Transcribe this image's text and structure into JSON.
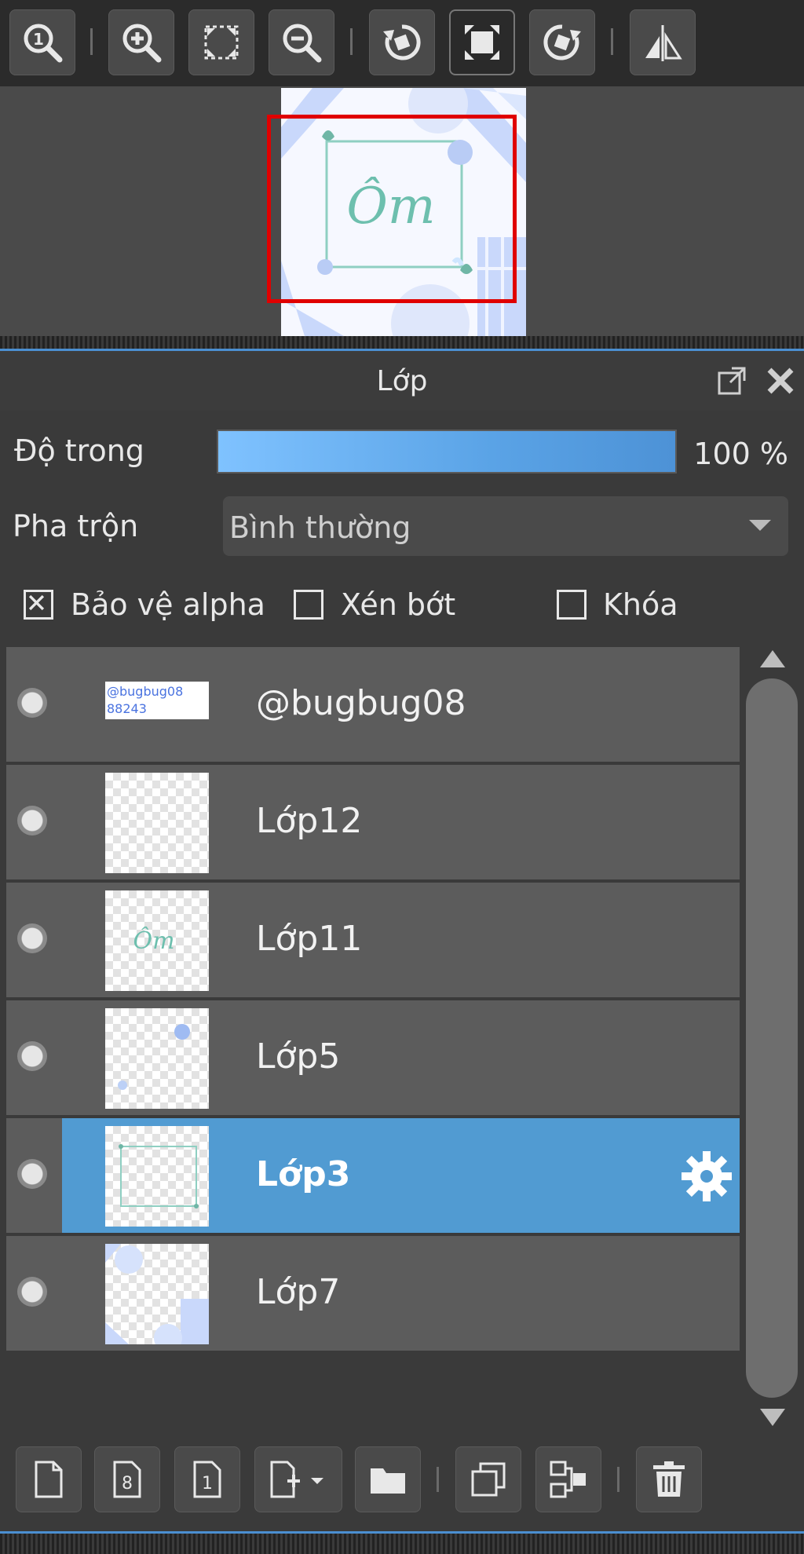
{
  "toolbar": {
    "buttons": [
      {
        "icon": "zoom-actual-size-icon"
      },
      {
        "icon": "zoom-in-icon"
      },
      {
        "icon": "fit-screen-icon"
      },
      {
        "icon": "zoom-out-icon"
      },
      {
        "icon": "rotate-left-icon"
      },
      {
        "icon": "fit-canvas-icon"
      },
      {
        "icon": "rotate-right-icon"
      },
      {
        "icon": "flip-horizontal-icon"
      }
    ]
  },
  "navigator": {
    "canvas_text": "Ôm"
  },
  "panel": {
    "title": "Lớp",
    "opacity_label": "Độ trong",
    "opacity_value": "100 %",
    "opacity_percent": 100,
    "blend_label": "Pha trộn",
    "blend_value": "Bình thường",
    "protect_alpha_label": "Bảo vệ alpha",
    "protect_alpha_checked": true,
    "clipping_label": "Xén bớt",
    "clipping_checked": false,
    "lock_label": "Khóa",
    "lock_checked": false
  },
  "layers": [
    {
      "name": "@bugbug08",
      "selected": false,
      "thumb_text_1": "@bugbug08",
      "thumb_text_2": "88243"
    },
    {
      "name": "Lớp12",
      "selected": false
    },
    {
      "name": "Lớp11",
      "selected": false,
      "thumb_text_1": "Ôm"
    },
    {
      "name": "Lớp5",
      "selected": false
    },
    {
      "name": "Lớp3",
      "selected": true
    },
    {
      "name": "Lớp7",
      "selected": false
    }
  ],
  "bottom_bar": {
    "buttons": [
      {
        "icon": "new-layer-icon"
      },
      {
        "icon": "new-8bit-layer-icon",
        "label": "8"
      },
      {
        "icon": "new-1bit-layer-icon",
        "label": "1"
      },
      {
        "icon": "add-layer-menu-icon"
      },
      {
        "icon": "new-folder-icon"
      },
      {
        "icon": "duplicate-layer-icon"
      },
      {
        "icon": "merge-down-icon"
      },
      {
        "icon": "delete-layer-icon"
      }
    ]
  },
  "colors": {
    "accent": "#519bd2",
    "viewport_frame": "#e00000"
  }
}
